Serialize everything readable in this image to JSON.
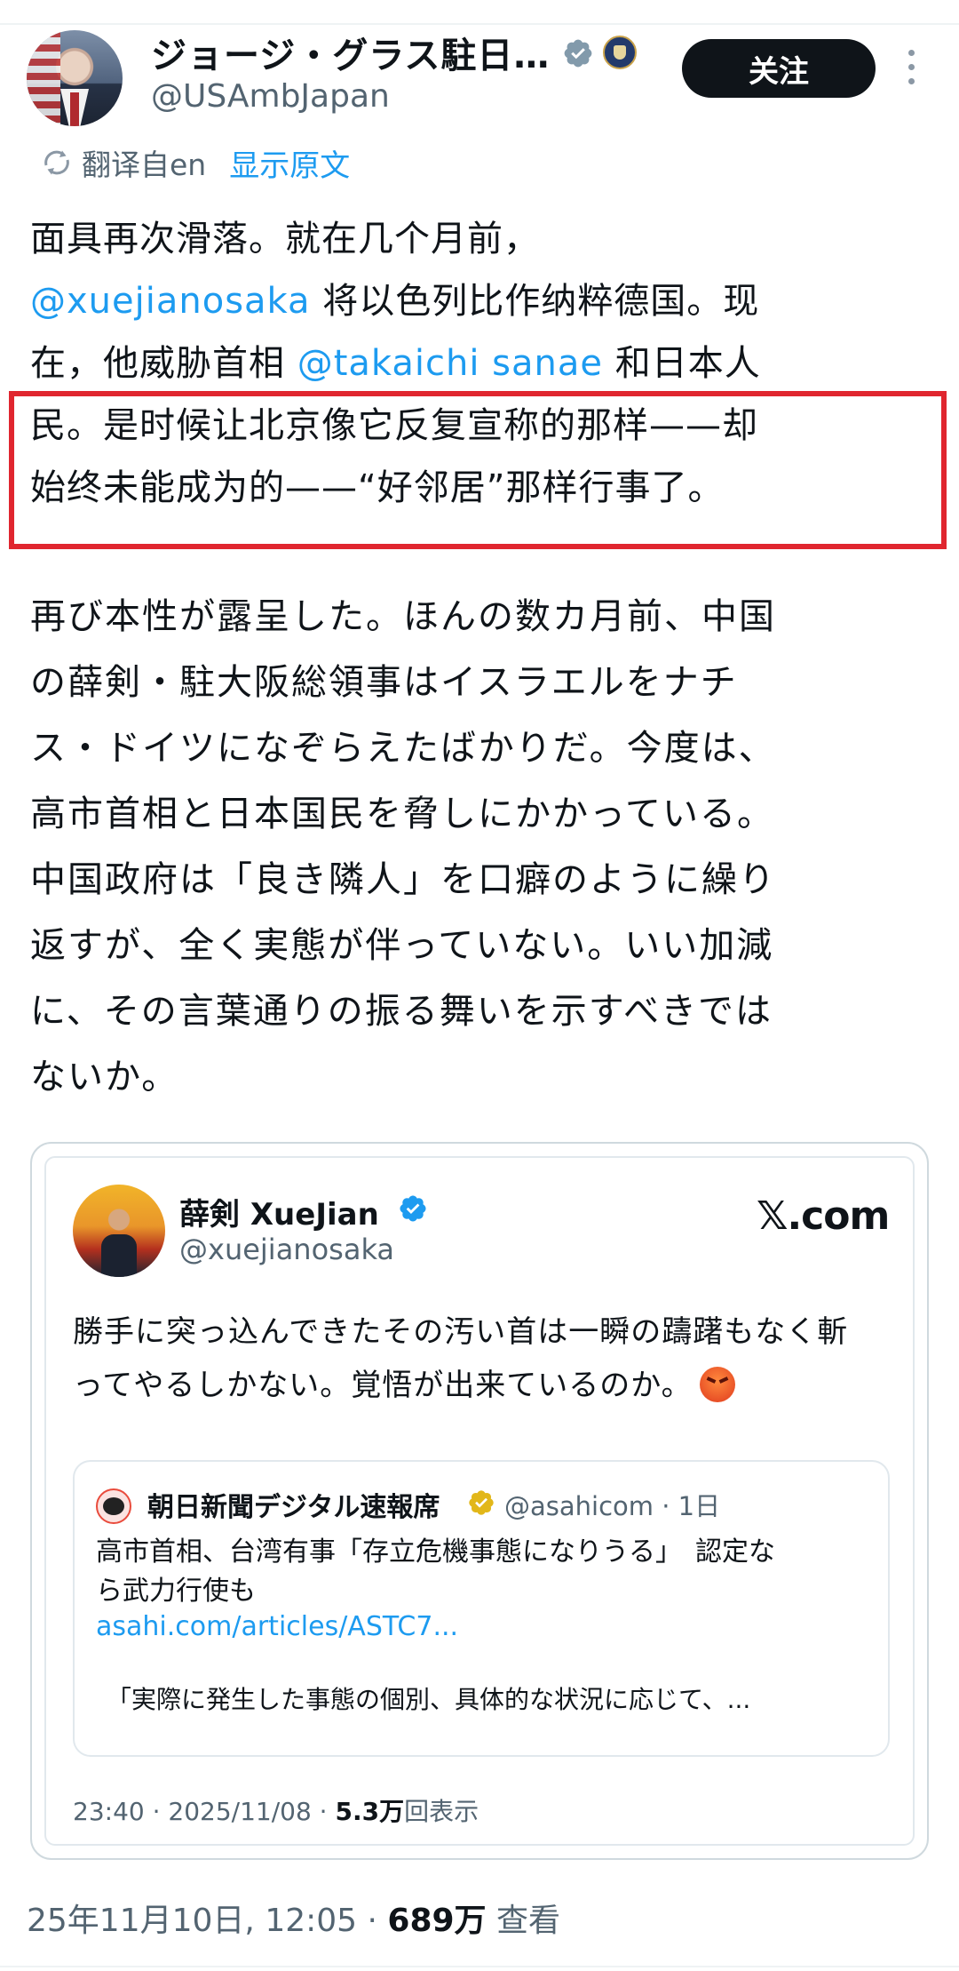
{
  "tweet": {
    "display_name": "ジョージ・グラス駐日…",
    "handle": "@USAmbJapan",
    "follow_label": "关注",
    "translated_from": "翻译自en",
    "show_original": "显示原文",
    "translated_lines": [
      [
        "面具再次滑落。就在几个月前，"
      ],
      [
        "@xuejianosaka",
        " 将以色列比作纳粹德国。现"
      ],
      [
        "在，他威胁首相 ",
        "@takaichi sanae",
        " 和日本人"
      ],
      [
        "民。是时候让北京像它反复宣称的那样——却"
      ],
      [
        "始终未能成为的——“好邻居”那样行事了。"
      ]
    ],
    "original_lines": [
      "再び本性が露呈した。ほんの数カ月前、中国",
      "の薛剣・駐大阪総領事はイスラエルをナチ",
      "ス・ドイツになぞらえたばかりだ。今度は、",
      "高市首相と日本国民を脅しにかかっている。",
      "中国政府は「良き隣人」を口癖のように繰り",
      "返すが、全く実態が伴っていない。いい加減",
      "に、その言葉通りの振る舞いを示すべきでは",
      "ないか。"
    ],
    "timestamp": "25年11月10日, 12:05 · ",
    "views_count": "689万",
    "views_label": " 查看"
  },
  "embed": {
    "name": "薛剣 XueJian",
    "handle": "@xuejianosaka",
    "site_logo": "𝕏.com",
    "text_lines": [
      "勝手に突っ込んできたその汚い首は一瞬の躊躇もなく斬",
      "ってやるしかない。覚悟が出来ているのか。"
    ],
    "quote": {
      "name": "朝日新聞デジタル速報席",
      "meta": "@asahicom · 1日",
      "headline_lines": [
        "高市首相、台湾有事「存立危機事態になりうる」　認定な",
        "ら武力行使も"
      ],
      "link": "asahi.com/articles/ASTC7...",
      "excerpt": "「実際に発生した事態の個別、具体的な状況に応じて、..."
    },
    "meta_time": "23:40 · 2025/11/08 · ",
    "meta_views": "5.3万",
    "meta_views_label": "回表示"
  },
  "colors": {
    "link_blue": "#1d9bf0",
    "highlight_red": "#e0262f",
    "button_black": "#0f1419",
    "secondary_text": "#536471"
  },
  "icons": [
    "verified-badge-icon",
    "state-dept-seal-icon",
    "more-options-icon",
    "translate-icon",
    "angry-face-emoji-icon"
  ]
}
